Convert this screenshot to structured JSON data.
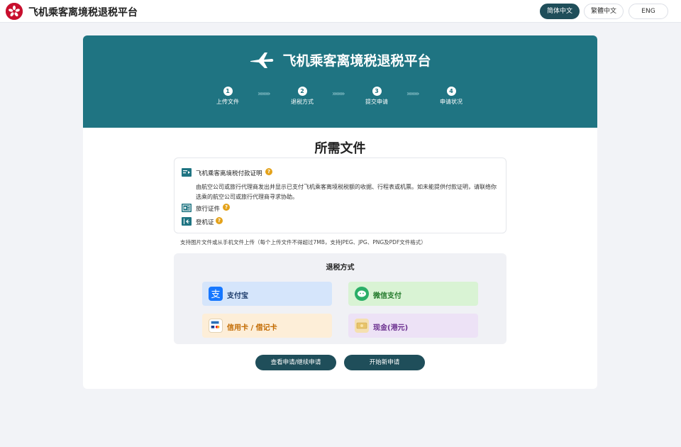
{
  "header": {
    "site_title": "飞机乘客离境税退税平台",
    "languages": [
      {
        "label": "简体中文",
        "active": true
      },
      {
        "label": "繁體中文",
        "active": false
      },
      {
        "label": "ENG",
        "active": false
      }
    ]
  },
  "hero": {
    "title": "飞机乘客离境税退税平台",
    "steps": [
      {
        "number": "1",
        "label": "上传文件"
      },
      {
        "number": "2",
        "label": "退税方式"
      },
      {
        "number": "3",
        "label": "提交申请"
      },
      {
        "number": "4",
        "label": "申请状况"
      }
    ],
    "separator": "»»»»"
  },
  "main": {
    "section_title": "所需文件",
    "documents": [
      {
        "label": "飞机乘客离境税付款证明",
        "icon": "receipt-icon",
        "help": "?"
      },
      {
        "label": "旅行证件",
        "icon": "passport-icon",
        "help": "?"
      },
      {
        "label": "登机证",
        "icon": "boarding-pass-icon",
        "help": "?"
      }
    ],
    "document_description": "由航空公司或旅行代理商发出并显示已支付飞机乘客离境税税额的收据、行程表或机票。如未能提供付款证明，请联络你选乘的航空公司或旅行代理商寻求协助。",
    "upload_note": "支持图片文件或从手机文件上传（每个上传文件不得超过7MB，支持JPEG、JPG、PNG及PDF文件格式）",
    "refund": {
      "title": "退税方式",
      "methods": [
        {
          "label": "支付宝",
          "icon": "alipay-icon",
          "color": "#1677ff"
        },
        {
          "label": "微信支付",
          "icon": "wechat-pay-icon",
          "color": "#2aae67"
        },
        {
          "label": "信用卡 / 借记卡",
          "icon": "credit-card-icon",
          "color": "#c26a00"
        },
        {
          "label": "现金(港元)",
          "icon": "cash-icon",
          "color": "#6b2f8f"
        }
      ]
    },
    "actions": [
      {
        "label": "查看申请/继续申请"
      },
      {
        "label": "开始新申请"
      }
    ]
  },
  "colors": {
    "hero_bg": "#1f7482",
    "button_bg": "#1f4e5a",
    "help_icon": "#e4a21a"
  }
}
